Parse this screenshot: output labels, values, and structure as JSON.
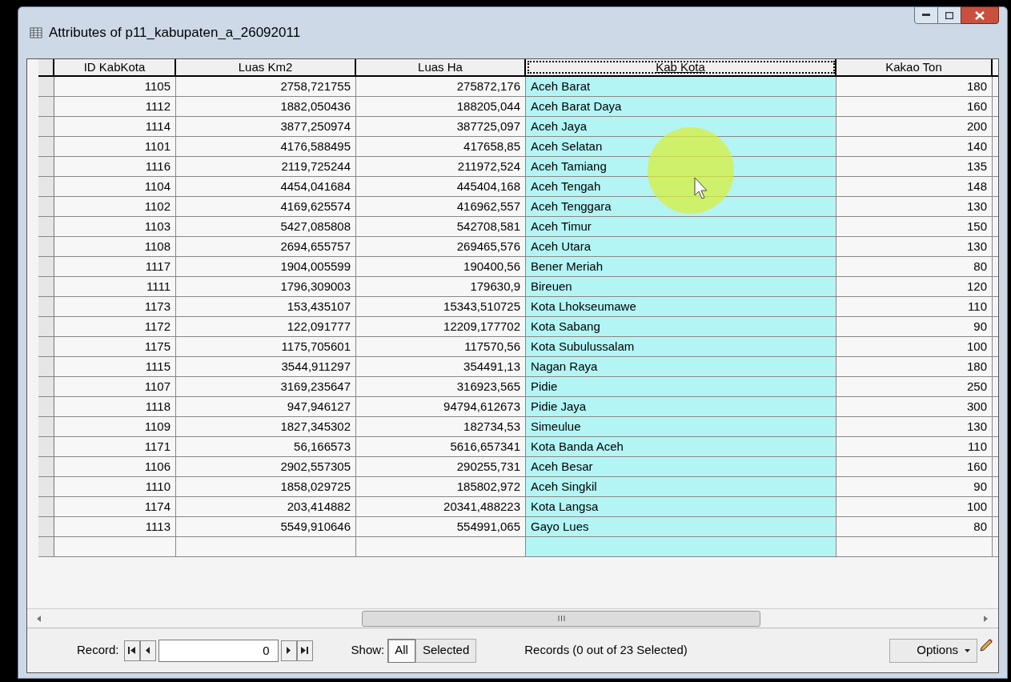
{
  "window": {
    "title": "Attributes of p11_kabupaten_a_26092011"
  },
  "table": {
    "columns": [
      {
        "label": "ID KabKota",
        "selected": false
      },
      {
        "label": "Luas Km2",
        "selected": false
      },
      {
        "label": "Luas Ha",
        "selected": false
      },
      {
        "label": "Kab Kota",
        "selected": true
      },
      {
        "label": "Kakao Ton",
        "selected": false
      }
    ],
    "rows": [
      [
        "1105",
        "2758,721755",
        "275872,176",
        "Aceh Barat",
        "180"
      ],
      [
        "1112",
        "1882,050436",
        "188205,044",
        "Aceh Barat Daya",
        "160"
      ],
      [
        "1114",
        "3877,250974",
        "387725,097",
        "Aceh Jaya",
        "200"
      ],
      [
        "1101",
        "4176,588495",
        "417658,85",
        "Aceh Selatan",
        "140"
      ],
      [
        "1116",
        "2119,725244",
        "211972,524",
        "Aceh Tamiang",
        "135"
      ],
      [
        "1104",
        "4454,041684",
        "445404,168",
        "Aceh Tengah",
        "148"
      ],
      [
        "1102",
        "4169,625574",
        "416962,557",
        "Aceh Tenggara",
        "130"
      ],
      [
        "1103",
        "5427,085808",
        "542708,581",
        "Aceh Timur",
        "150"
      ],
      [
        "1108",
        "2694,655757",
        "269465,576",
        "Aceh Utara",
        "130"
      ],
      [
        "1117",
        "1904,005599",
        "190400,56",
        "Bener Meriah",
        "80"
      ],
      [
        "1111",
        "1796,309003",
        "179630,9",
        "Bireuen",
        "120"
      ],
      [
        "1173",
        "153,435107",
        "15343,510725",
        "Kota Lhokseumawe",
        "110"
      ],
      [
        "1172",
        "122,091777",
        "12209,177702",
        "Kota Sabang",
        "90"
      ],
      [
        "1175",
        "1175,705601",
        "117570,56",
        "Kota Subulussalam",
        "100"
      ],
      [
        "1115",
        "3544,911297",
        "354491,13",
        "Nagan Raya",
        "180"
      ],
      [
        "1107",
        "3169,235647",
        "316923,565",
        "Pidie",
        "250"
      ],
      [
        "1118",
        "947,946127",
        "94794,612673",
        "Pidie Jaya",
        "300"
      ],
      [
        "1109",
        "1827,345302",
        "182734,53",
        "Simeulue",
        "130"
      ],
      [
        "1171",
        "56,166573",
        "5616,657341",
        "Kota Banda Aceh",
        "110"
      ],
      [
        "1106",
        "2902,557305",
        "290255,731",
        "Aceh Besar",
        "160"
      ],
      [
        "1110",
        "1858,029725",
        "185802,972",
        "Aceh Singkil",
        "90"
      ],
      [
        "1174",
        "203,414882",
        "20341,488223",
        "Kota Langsa",
        "100"
      ],
      [
        "1113",
        "5549,910646",
        "554991,065",
        "Gayo Lues",
        "80"
      ]
    ]
  },
  "toolbar": {
    "record_label": "Record:",
    "record_value": "0",
    "show_label": "Show:",
    "show_buttons": [
      {
        "label": "All",
        "selected": true
      },
      {
        "label": "Selected",
        "selected": false
      }
    ],
    "status": "Records (0 out of 23 Selected)",
    "options": "Options"
  }
}
